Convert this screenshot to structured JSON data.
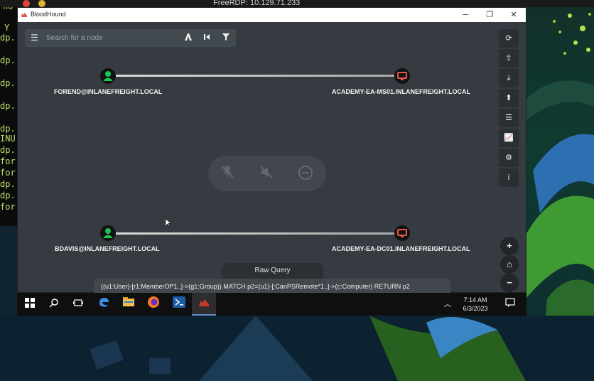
{
  "host": {
    "rdp_title": "FreeRDP: 10.129.71.233",
    "terminal_lines": [
      "ho",
      "Y",
      "dp.",
      "dp.",
      "dp.",
      "dp.",
      "dp.",
      "INU",
      "dp.",
      "for",
      "for",
      "dp.",
      "dp.",
      "for"
    ]
  },
  "window": {
    "title": "BloodHound",
    "minimize": "─",
    "maximize": "❐",
    "close": "✕"
  },
  "search": {
    "placeholder": "Search for a node",
    "menu_icon": "hamburger-icon",
    "tools": [
      "pathfinding-icon",
      "back-icon",
      "filter-icon"
    ]
  },
  "graph": {
    "path1": {
      "user": "FOREND@INLANEFREIGHT.LOCAL",
      "computer": "ACADEMY-EA-MS01.INLANEFREIGHT.LOCAL"
    },
    "path2": {
      "user": "BDAVIS@INLANEFREIGHT.LOCAL",
      "computer": "ACADEMY-EA-DC01.INLANEFREIGHT.LOCAL"
    },
    "overlay_icons": [
      "pin-off-icon",
      "mute-icon",
      "minus-circle-icon"
    ]
  },
  "sidebar_buttons": [
    "refresh-icon",
    "upload-icon",
    "download-icon",
    "upload-circle-icon",
    "list-icon",
    "chart-icon",
    "settings-icon",
    "info-icon"
  ],
  "zoom_buttons": [
    "+",
    "⌂",
    "−"
  ],
  "raw_query": {
    "label": "Raw Query",
    "value": "((u1:User)-[r1:MemberOf*1..]->(g1:Group)) MATCH p2=(u1)-[:CanPSRemote*1..]->(c:Computer) RETURN p2"
  },
  "taskbar": {
    "time": "7:14 AM",
    "date": "6/3/2023",
    "apps": [
      "windows-start-icon",
      "search-icon",
      "task-view-icon",
      "edge-icon",
      "file-explorer-icon",
      "firefox-icon",
      "powershell-icon",
      "bloodhound-icon"
    ]
  },
  "colors": {
    "user_node": "#17c653",
    "computer_node": "#e9573f",
    "graph_bg": "#353b40"
  }
}
